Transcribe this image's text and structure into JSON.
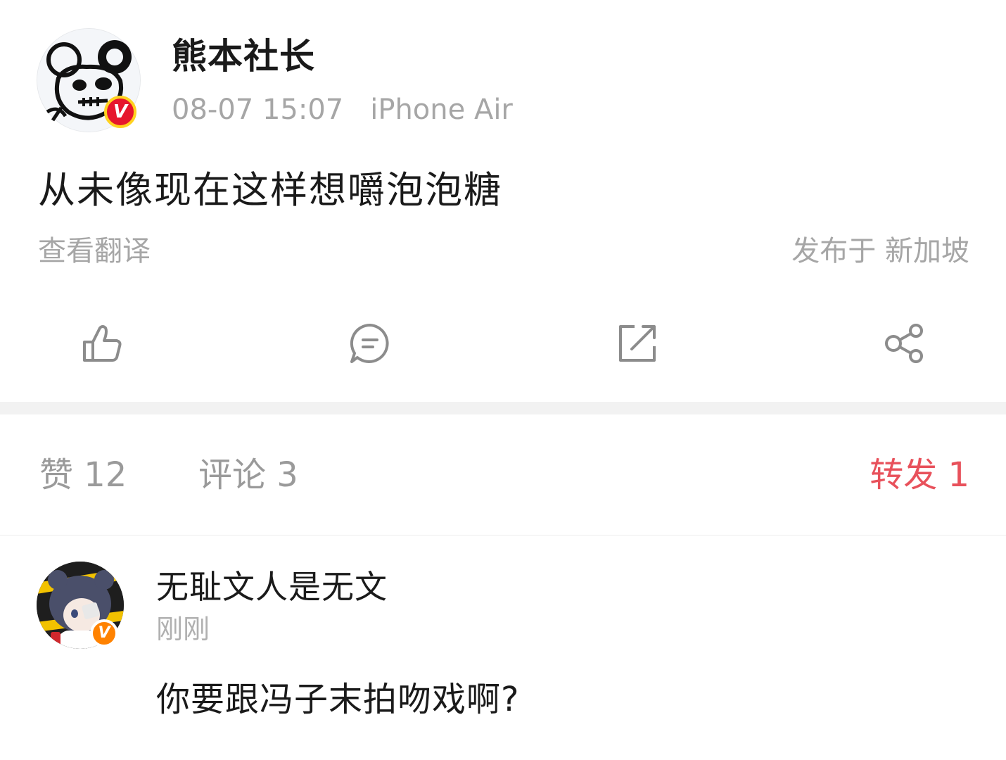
{
  "post": {
    "username": "熊本社长",
    "time": "08-07 15:07",
    "device": "iPhone Air",
    "text": "从未像现在这样想嚼泡泡糖",
    "translate_label": "查看翻译",
    "location": "发布于 新加坡",
    "avatar_badge": "V"
  },
  "actions": [
    {
      "icon": "like-icon"
    },
    {
      "icon": "comment-icon"
    },
    {
      "icon": "repost-icon"
    },
    {
      "icon": "share-icon"
    }
  ],
  "stats": {
    "likes": "赞 12",
    "comments": "评论 3",
    "reposts": "转发 1"
  },
  "comment": {
    "username": "无耻文人是无文",
    "time": "刚刚",
    "text": "你要跟冯子末拍吻戏啊?",
    "avatar_badge": "V"
  },
  "colors": {
    "accent_red": "#e8515b",
    "badge_red": "#e6162d",
    "badge_orange": "#ff8200",
    "muted_text": "#a6a6a6"
  }
}
